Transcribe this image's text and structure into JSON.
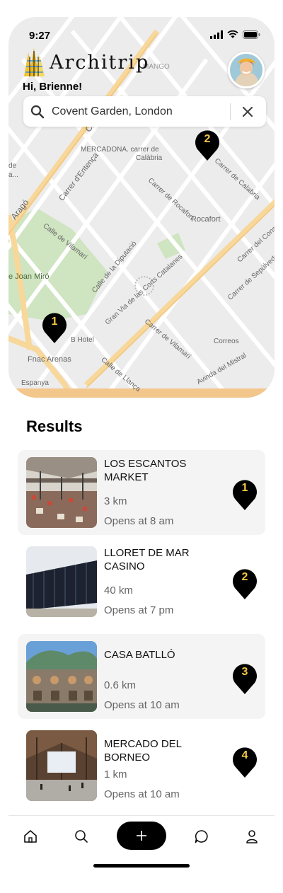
{
  "status_bar": {
    "time": "9:27"
  },
  "app": {
    "name": "Architrip",
    "greeting": "Hi, Brienne!"
  },
  "search": {
    "value": "Covent Garden, London"
  },
  "map": {
    "labels": {
      "mercadona": "MERCADONA. carrer de",
      "calabria": "Calàbria",
      "mango": "MANGO",
      "rocafort_metro": "Rocafort",
      "joan_miro": "e Joan Miró",
      "hotel": "B Hotel",
      "fnac": "Fnac Arenas",
      "correos": "Correos",
      "espanya": "Espanya",
      "street_entenca": "Carrer d'Entença",
      "street_vilamari": "Calle de Vilamarí",
      "street_diputacio": "Calle de la Diputació",
      "street_rocafort": "Carrer de Rocafort",
      "street_calabria": "Carrer de Calabria",
      "street_gran_via": "Gran Via de las Corts Catalanes",
      "street_vilamari_2": "Carrer de Vilamarí",
      "street_llanca": "Calle de Llança",
      "street_mistral": "Avinda del Mistral",
      "street_sepulveda": "Carrer de Sepúlveda",
      "street_consell": "Carrer del Consell de Cent",
      "street_aragon": "Aragó",
      "street_ca": "Ca",
      "map_left_a": "de",
      "map_left_b": "a..."
    },
    "pins": [
      {
        "number": "1"
      },
      {
        "number": "2"
      }
    ]
  },
  "results": {
    "title": "Results",
    "items": [
      {
        "name": "LOS ESCANTOS MARKET",
        "distance": "3 km",
        "hours": "Opens at 8 am",
        "pin": "1"
      },
      {
        "name": "LLORET DE MAR CASINO",
        "distance": "40 km",
        "hours": "Opens at 7 pm",
        "pin": "2"
      },
      {
        "name": "CASA BATLLÓ",
        "distance": "0.6 km",
        "hours": "Opens at 10 am",
        "pin": "3"
      },
      {
        "name": "MERCADO DEL BORNEO",
        "distance": "1 km",
        "hours": "Opens at 10 am",
        "pin": "4"
      }
    ]
  },
  "nav": {
    "items": [
      {
        "icon": "home-icon"
      },
      {
        "icon": "search-icon"
      },
      {
        "icon": "plus-icon"
      },
      {
        "icon": "chat-icon"
      },
      {
        "icon": "profile-icon"
      }
    ]
  },
  "colors": {
    "pin": "#000000",
    "pin_number": "#f6c844",
    "road_major": "#f7d79a",
    "park": "#cfe4c0"
  }
}
